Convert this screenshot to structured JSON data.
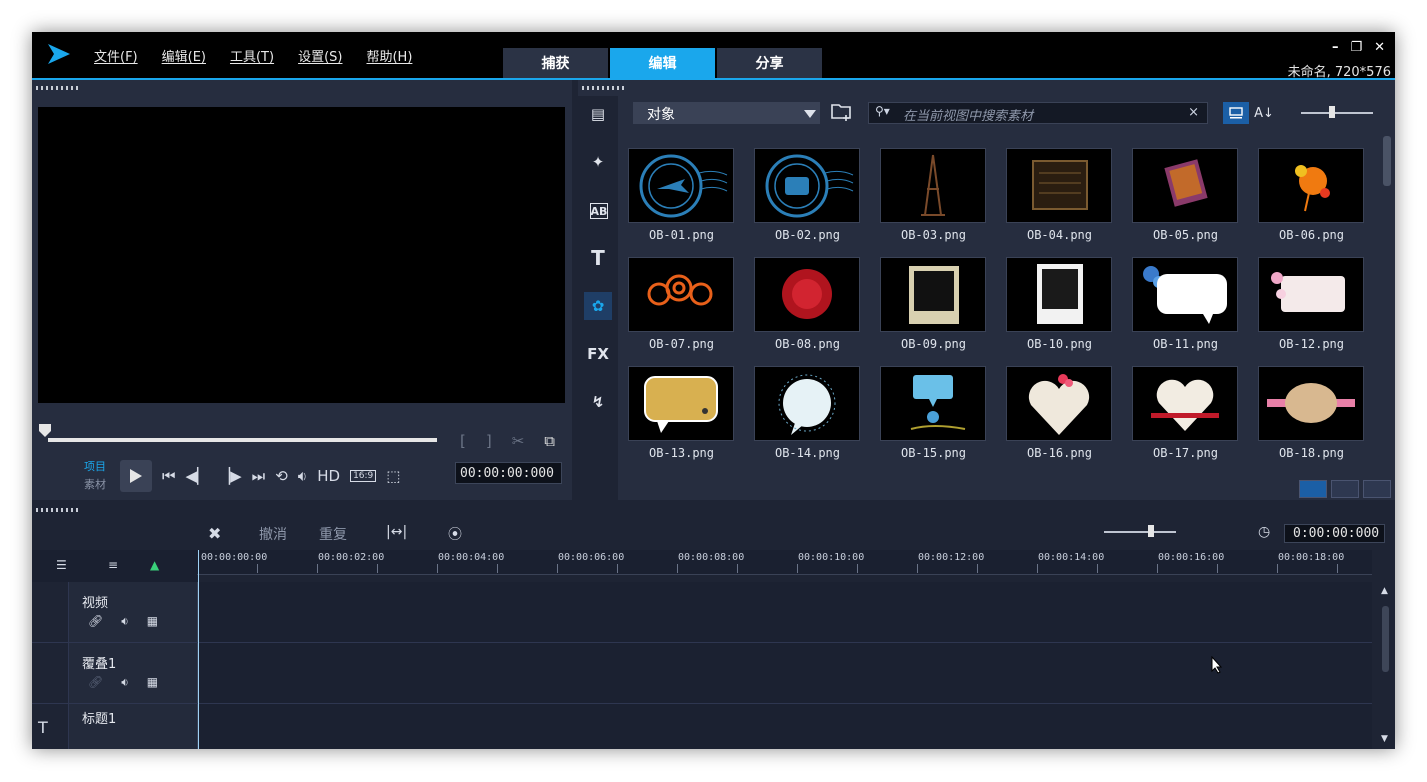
{
  "app": {
    "menu": [
      "文件(F)",
      "编辑(E)",
      "工具(T)",
      "设置(S)",
      "帮助(H)"
    ],
    "mode_tabs": [
      "捕获",
      "编辑",
      "分享"
    ],
    "active_mode": "编辑",
    "window_controls": [
      "–",
      "❐",
      "✕"
    ],
    "project_info": "未命名, 720*576"
  },
  "player": {
    "mode_project": "项目",
    "mode_clip": "素材",
    "aspect": "16:9",
    "hd_label": "HD",
    "timecode": "00:00:00:000",
    "mark_in": "[",
    "mark_out": "]"
  },
  "library": {
    "category": "对象",
    "search_placeholder": "在当前视图中搜索素材",
    "search_clear": "×",
    "side_tools": [
      "media-icon",
      "instant-project-icon",
      "transition-icon",
      "title-icon",
      "graphics-icon",
      "filter-icon",
      "path-icon"
    ],
    "side_fx_label": "FX",
    "items": [
      "OB-01.png",
      "OB-02.png",
      "OB-03.png",
      "OB-04.png",
      "OB-05.png",
      "OB-06.png",
      "OB-07.png",
      "OB-08.png",
      "OB-09.png",
      "OB-10.png",
      "OB-11.png",
      "OB-12.png",
      "OB-13.png",
      "OB-14.png",
      "OB-15.png",
      "OB-16.png",
      "OB-17.png",
      "OB-18.png"
    ]
  },
  "timeline": {
    "undo": "撤消",
    "redo": "重复",
    "timecode": "0:00:00:000",
    "ticks": [
      "00:00:00:00",
      "00:00:02:00",
      "00:00:04:00",
      "00:00:06:00",
      "00:00:08:00",
      "00:00:10:00",
      "00:00:12:00",
      "00:00:14:00",
      "00:00:16:00",
      "00:00:18:00"
    ],
    "tracks": [
      "视频",
      "覆叠1",
      "标题1"
    ]
  },
  "colors": {
    "accent": "#1aa7ec",
    "panel": "#262d3f",
    "background": "#1e2434"
  }
}
